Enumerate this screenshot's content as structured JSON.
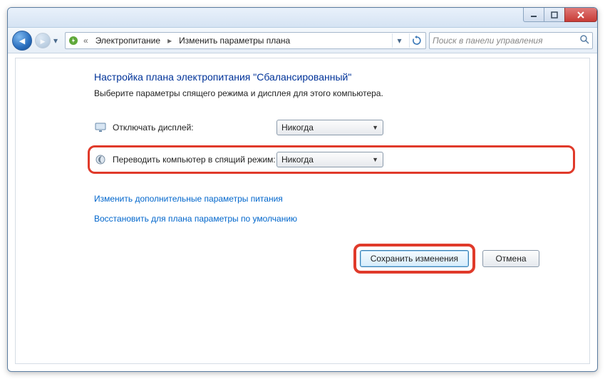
{
  "titlebar": {
    "min_tip": "Minimize",
    "max_tip": "Maximize",
    "close_tip": "Close"
  },
  "breadcrumb": {
    "root_sep": "«",
    "item1": "Электропитание",
    "item2": "Изменить параметры плана"
  },
  "search": {
    "placeholder": "Поиск в панели управления"
  },
  "page": {
    "title": "Настройка плана электропитания \"Сбалансированный\"",
    "subtitle": "Выберите параметры спящего режима и дисплея для этого компьютера."
  },
  "settings": {
    "display_off": {
      "label": "Отключать дисплей:",
      "value": "Никогда"
    },
    "sleep": {
      "label": "Переводить компьютер в спящий режим:",
      "value": "Никогда"
    }
  },
  "links": {
    "advanced": "Изменить дополнительные параметры питания",
    "restore": "Восстановить для плана параметры по умолчанию"
  },
  "buttons": {
    "save": "Сохранить изменения",
    "cancel": "Отмена"
  }
}
